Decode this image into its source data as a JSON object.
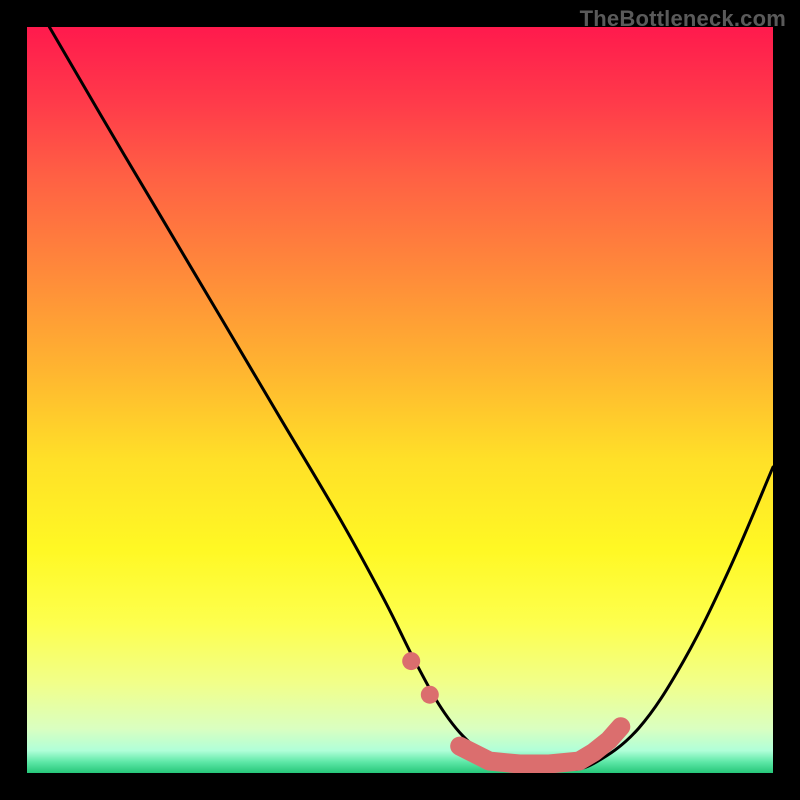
{
  "watermark": "TheBottleneck.com",
  "colors": {
    "page_bg": "#000000",
    "curve_stroke": "#000000",
    "marker_stroke": "#db6e6e",
    "gradient_stops": [
      "#ff1a4d",
      "#ff3a4a",
      "#ff6044",
      "#ff8a3a",
      "#ffb530",
      "#ffe028",
      "#fff824",
      "#fdff4e",
      "#f1ff8a",
      "#daffc0",
      "#b0ffd8",
      "#5fe8a8",
      "#26c77a"
    ]
  },
  "chart_data": {
    "type": "line",
    "title": "",
    "xlabel": "",
    "ylabel": "",
    "xlim": [
      0,
      100
    ],
    "ylim": [
      0,
      100
    ],
    "series": [
      {
        "name": "bottleneck-curve",
        "x": [
          3,
          10,
          18,
          26,
          34,
          42,
          48,
          52,
          56,
          60,
          64,
          68,
          72,
          76,
          82,
          88,
          94,
          100
        ],
        "y": [
          100,
          88,
          74.5,
          61,
          47.5,
          34,
          23,
          15,
          8,
          3.5,
          1.2,
          0.4,
          0.4,
          1.3,
          6,
          15,
          27,
          41
        ]
      }
    ],
    "markers": [
      {
        "name": "dot-left-upper",
        "x": 51.5,
        "y": 15.0
      },
      {
        "name": "dot-left-lower",
        "x": 54.0,
        "y": 10.5
      },
      {
        "name": "flat-start",
        "x": 58.0,
        "y": 3.6
      },
      {
        "name": "flat-a",
        "x": 62.0,
        "y": 1.6
      },
      {
        "name": "flat-b",
        "x": 66.0,
        "y": 1.2
      },
      {
        "name": "flat-c",
        "x": 70.0,
        "y": 1.2
      },
      {
        "name": "flat-end",
        "x": 74.0,
        "y": 1.6
      },
      {
        "name": "rise-a",
        "x": 76.0,
        "y": 2.8
      },
      {
        "name": "rise-b",
        "x": 78.0,
        "y": 4.4
      },
      {
        "name": "rise-c",
        "x": 79.6,
        "y": 6.2
      }
    ]
  }
}
